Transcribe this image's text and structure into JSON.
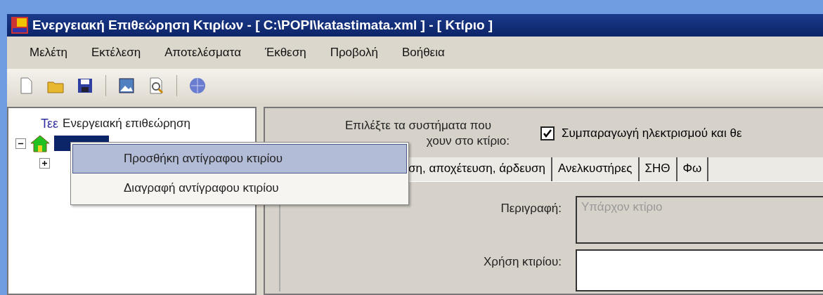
{
  "window": {
    "title": "Ενεργειακή Επιθεώρηση Κτιρίων - [ C:\\POPI\\katastimata.xml ] - [ Κτίριο ]"
  },
  "menu_bar": [
    "Μελέτη",
    "Εκτέλεση",
    "Αποτελέσματα",
    "Έκθεση",
    "Προβολή",
    "Βοήθεια"
  ],
  "tree": {
    "logo": "Τεε",
    "label": "Ενεργειακή επιθεώρηση",
    "children": [
      {
        "selected": true,
        "expanded": true,
        "children": [
          {
            "expanded": false
          }
        ]
      }
    ]
  },
  "context_menu": [
    {
      "label": "Προσθήκη αντίγραφου κτιρίου",
      "selected": true
    },
    {
      "label": "Διαγραφή αντίγραφου κτιρίου",
      "selected": false
    }
  ],
  "systems": {
    "label_line_1": "Επιλέξτε τα συστήματα που",
    "label_line_2": "χουν στο κτίριο:",
    "checkbox": {
      "label": "Συμπαραγωγή ηλεκτρισμού και θε",
      "checked": true
    }
  },
  "tabs": [
    {
      "label": "ση, αποχέτευση, άρδευση",
      "selected": false
    },
    {
      "label": "Ανελκυστήρες",
      "selected": false
    },
    {
      "label": "ΣΗΘ",
      "selected": false
    },
    {
      "label": "Φω",
      "selected": false
    }
  ],
  "form": [
    {
      "label": "Περιγραφή:",
      "value": "Υπάρχον κτίριο",
      "disabled": true
    },
    {
      "label": "Χρήση κτιρίου:",
      "disabled": false
    }
  ]
}
